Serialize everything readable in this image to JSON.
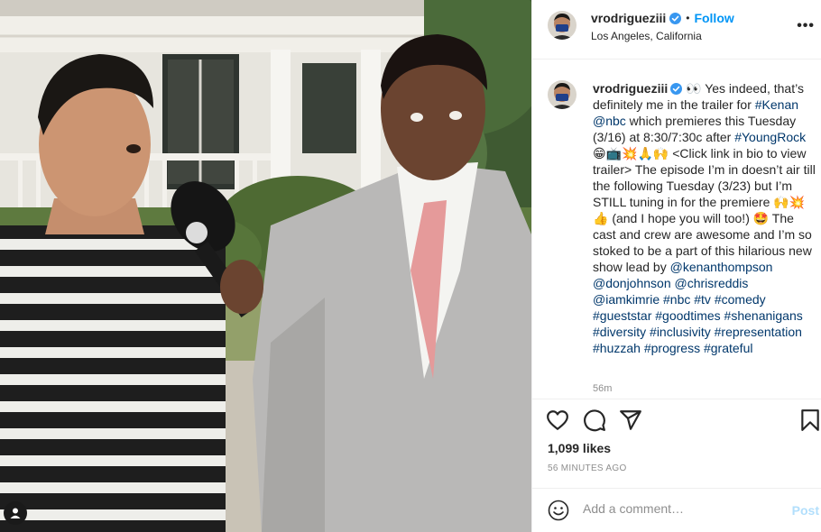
{
  "post": {
    "username": "vrodrigueziii",
    "follow_label": "Follow",
    "dot": "•",
    "location": "Los Angeles, California",
    "more_label": "•••"
  },
  "caption": {
    "username": "vrodrigueziii",
    "t1": " 👀 Yes indeed, that’s definitely me in the trailer for ",
    "tag_kenan": "#Kenan",
    "t2": " ",
    "mention_nbc": "@nbc",
    "t3": " which premieres this Tuesday (3/16) at 8:30/7:30c after ",
    "tag_youngrock": "#YoungRock",
    "t4": " 😁📺💥🙏🙌 <Click link in bio to view trailer> The episode I’m in doesn’t air till the following Tuesday (3/23) but I’m STILL tuning in for the premiere 🙌💥👍 (and I hope you will too!) 🤩 The cast and crew are awesome and I’m so stoked to be a part of this hilarious new show lead by ",
    "mentions": [
      "@kenanthompson",
      "@donjohnson",
      "@chrisreddis",
      "@iamkimrie"
    ],
    "hashtags": [
      "#nbc",
      "#tv",
      "#comedy",
      "#gueststar",
      "#goodtimes",
      "#shenanigans",
      "#diversity",
      "#inclusivity",
      "#representation",
      "#huzzah",
      "#progress",
      "#grateful"
    ],
    "time": "56m"
  },
  "engagement": {
    "likes": "1,099 likes",
    "posted_ago": "56 MINUTES AGO"
  },
  "comment": {
    "placeholder": "Add a comment…",
    "post_label": "Post"
  },
  "colors": {
    "link": "#00376b",
    "follow": "#0095f6",
    "post_disabled": "#b2dffc",
    "muted": "#8e8e8e"
  },
  "icons": [
    "verified-badge-icon",
    "more-options-icon",
    "heart-icon",
    "comment-icon",
    "share-icon",
    "bookmark-icon",
    "emoji-icon",
    "user-tag-icon"
  ]
}
